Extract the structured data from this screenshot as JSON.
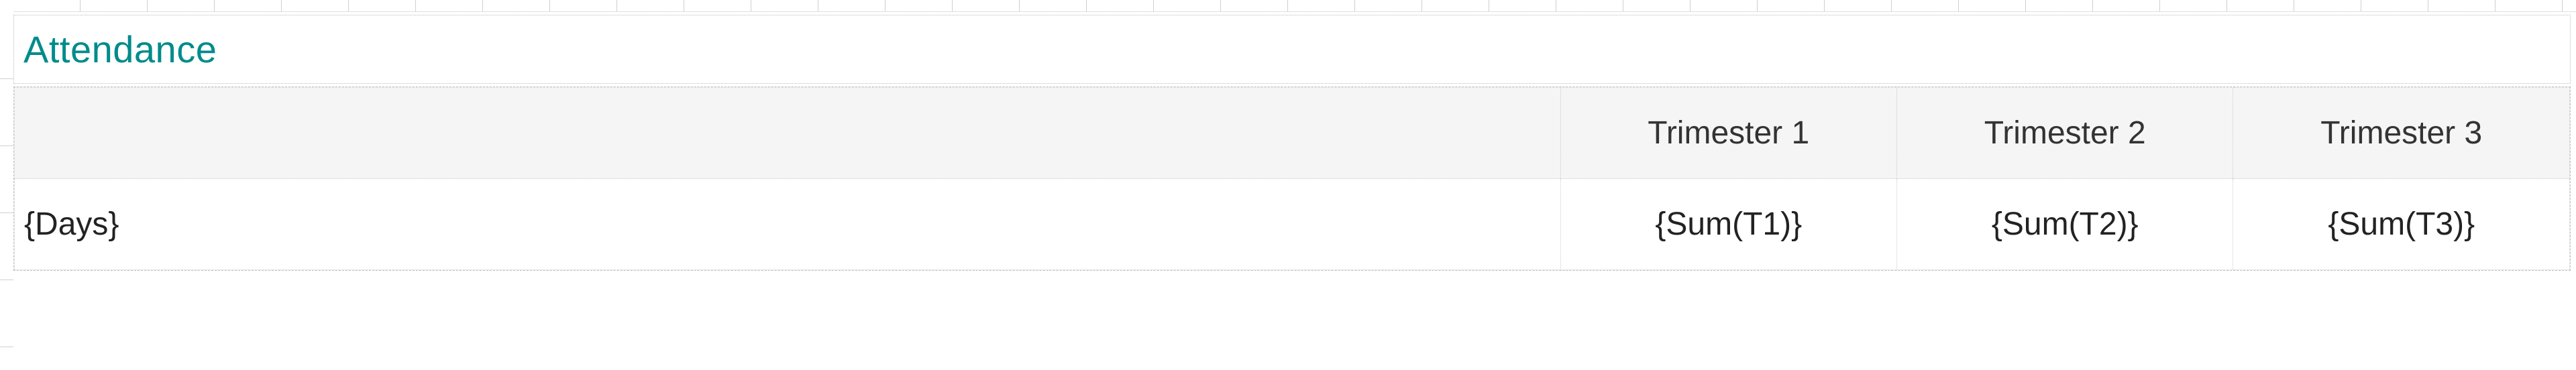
{
  "section": {
    "title": "Attendance"
  },
  "table": {
    "headers": {
      "blank": "",
      "col1": "Trimester 1",
      "col2": "Trimester 2",
      "col3": "Trimester 3"
    },
    "row": {
      "label": "{Days}",
      "c1": "{Sum(T1)}",
      "c2": "{Sum(T2)}",
      "c3": "{Sum(T3)}"
    }
  }
}
